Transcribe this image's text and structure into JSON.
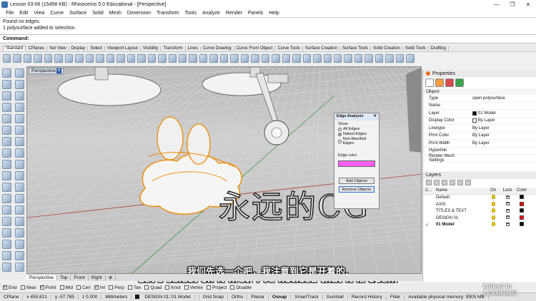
{
  "window": {
    "title": "Lesson 03-06 (15458 KB) - Rhinoceros 5.0 Educational - [Perspective]",
    "controls": [
      "—",
      "❐",
      "✕"
    ]
  },
  "menu": [
    "File",
    "Edit",
    "View",
    "Curve",
    "Surface",
    "Solid",
    "Mesh",
    "Dimension",
    "Transform",
    "Tools",
    "Analyze",
    "Render",
    "Panels",
    "Help"
  ],
  "command_history": [
    "Found no edges.",
    "1 polysurface added to selection."
  ],
  "command": {
    "label": "Command:",
    "value": ""
  },
  "toolbar_tabs": [
    "Standard",
    "CPlanes",
    "Set View",
    "Display",
    "Select",
    "Viewport Layout",
    "Visibility",
    "Transform",
    "Lines",
    "Curve Drawing",
    "Curve From Object",
    "Curve Tools",
    "Surface Creation",
    "Surface Tools",
    "Solid Creation",
    "Solid Tools",
    "Drafting"
  ],
  "viewport": {
    "title": "Perspective"
  },
  "edge_analysis": {
    "title": "Edge Analysis",
    "show_label": "Show",
    "options": [
      "All Edges",
      "Naked Edges",
      "Non-Manifold Edges"
    ],
    "selected": "Naked Edges",
    "edge_color_label": "Edge color",
    "edge_color": "#ff5ef0",
    "add_button": "Add Objects",
    "remove_button": "Remove Objects"
  },
  "watermark": "永远的CG",
  "subtitles": {
    "chinese": "我们先选一个吧，我注意到它是开着的,",
    "english": "Let's select on it first, I've noticed that it is open,"
  },
  "viewport_tabs": [
    "Perspective",
    "Top",
    "Front",
    "Right"
  ],
  "osnap": {
    "items": [
      {
        "label": "End",
        "checked": true
      },
      {
        "label": "Near",
        "checked": false
      },
      {
        "label": "Point",
        "checked": true
      },
      {
        "label": "Mid",
        "checked": false
      },
      {
        "label": "Cen",
        "checked": false
      },
      {
        "label": "Int",
        "checked": true
      },
      {
        "label": "Perp",
        "checked": false
      },
      {
        "label": "Tan",
        "checked": false
      },
      {
        "label": "Quad",
        "checked": false
      },
      {
        "label": "Knot",
        "checked": false
      },
      {
        "label": "Vertex",
        "checked": false
      },
      {
        "label": "Project",
        "checked": false
      },
      {
        "label": "Disable",
        "checked": false
      }
    ]
  },
  "status": {
    "cplane": "CPlane",
    "x": "x 455.821",
    "y": "y -57.785",
    "z": "z 0.000",
    "units": "Millimeters",
    "layer": "DESIGN 01::01 Model",
    "toggles": [
      "Grid Snap",
      "Ortho",
      "Planar",
      "Osnap",
      "SmartTrack",
      "Gumball",
      "Record History",
      "Filter"
    ],
    "memory": "Available physical memory: 9905 MB"
  },
  "properties": {
    "title": "Properties",
    "section": "Object",
    "rows": [
      {
        "k": "Type",
        "v": "open polysurface"
      },
      {
        "k": "Name",
        "v": ""
      },
      {
        "k": "Layer",
        "v": "01 Model"
      },
      {
        "k": "Display Color",
        "v": "By Layer"
      },
      {
        "k": "Linetype",
        "v": "By Layer"
      },
      {
        "k": "Print Color",
        "v": "By Layer"
      },
      {
        "k": "Print Width",
        "v": "By Layer"
      },
      {
        "k": "Hyperlink",
        "v": ""
      },
      {
        "k": "Render Mesh Settings",
        "v": ""
      }
    ]
  },
  "layers": {
    "title": "Layers",
    "headers": [
      "C...",
      "Name",
      "On",
      "Lock",
      "Color"
    ],
    "rows": [
      {
        "name": "Default",
        "color": "#000000"
      },
      {
        "name": "AXIS",
        "color": "#ff0000"
      },
      {
        "name": "TITLES & TEXT",
        "color": "#000000"
      },
      {
        "name": "DESIGN 01",
        "color": "#ff0000"
      },
      {
        "name": "01 Model",
        "color": "#000000",
        "current": true
      }
    ]
  },
  "brand": "Linked in LEARNING"
}
